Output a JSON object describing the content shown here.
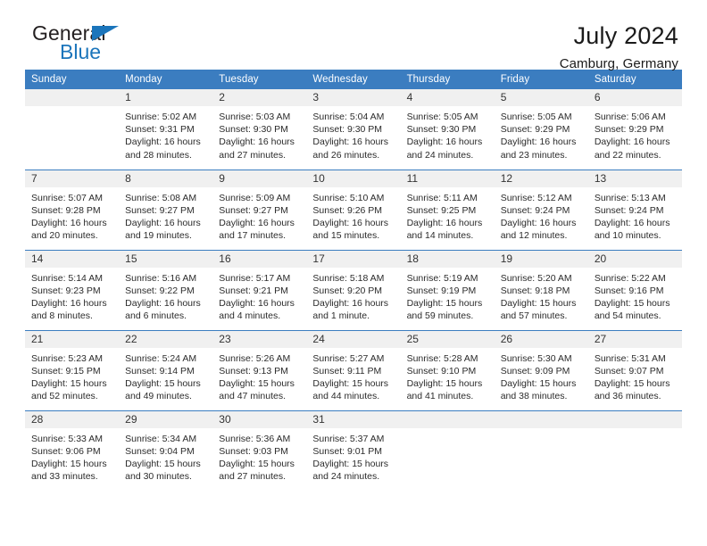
{
  "brand": {
    "name_top": "General",
    "name_bottom": "Blue",
    "accent_color": "#1b75bb"
  },
  "header": {
    "title": "July 2024",
    "subtitle": "Camburg, Germany"
  },
  "calendar": {
    "header_bg": "#3b7dc0",
    "weekdays": [
      "Sunday",
      "Monday",
      "Tuesday",
      "Wednesday",
      "Thursday",
      "Friday",
      "Saturday"
    ],
    "weeks": [
      [
        {
          "day": "",
          "blank": true,
          "sunrise": "",
          "sunset": "",
          "daylight1": "",
          "daylight2": ""
        },
        {
          "day": "1",
          "blank": false,
          "sunrise": "Sunrise: 5:02 AM",
          "sunset": "Sunset: 9:31 PM",
          "daylight1": "Daylight: 16 hours",
          "daylight2": "and 28 minutes."
        },
        {
          "day": "2",
          "blank": false,
          "sunrise": "Sunrise: 5:03 AM",
          "sunset": "Sunset: 9:30 PM",
          "daylight1": "Daylight: 16 hours",
          "daylight2": "and 27 minutes."
        },
        {
          "day": "3",
          "blank": false,
          "sunrise": "Sunrise: 5:04 AM",
          "sunset": "Sunset: 9:30 PM",
          "daylight1": "Daylight: 16 hours",
          "daylight2": "and 26 minutes."
        },
        {
          "day": "4",
          "blank": false,
          "sunrise": "Sunrise: 5:05 AM",
          "sunset": "Sunset: 9:30 PM",
          "daylight1": "Daylight: 16 hours",
          "daylight2": "and 24 minutes."
        },
        {
          "day": "5",
          "blank": false,
          "sunrise": "Sunrise: 5:05 AM",
          "sunset": "Sunset: 9:29 PM",
          "daylight1": "Daylight: 16 hours",
          "daylight2": "and 23 minutes."
        },
        {
          "day": "6",
          "blank": false,
          "sunrise": "Sunrise: 5:06 AM",
          "sunset": "Sunset: 9:29 PM",
          "daylight1": "Daylight: 16 hours",
          "daylight2": "and 22 minutes."
        }
      ],
      [
        {
          "day": "7",
          "blank": false,
          "sunrise": "Sunrise: 5:07 AM",
          "sunset": "Sunset: 9:28 PM",
          "daylight1": "Daylight: 16 hours",
          "daylight2": "and 20 minutes."
        },
        {
          "day": "8",
          "blank": false,
          "sunrise": "Sunrise: 5:08 AM",
          "sunset": "Sunset: 9:27 PM",
          "daylight1": "Daylight: 16 hours",
          "daylight2": "and 19 minutes."
        },
        {
          "day": "9",
          "blank": false,
          "sunrise": "Sunrise: 5:09 AM",
          "sunset": "Sunset: 9:27 PM",
          "daylight1": "Daylight: 16 hours",
          "daylight2": "and 17 minutes."
        },
        {
          "day": "10",
          "blank": false,
          "sunrise": "Sunrise: 5:10 AM",
          "sunset": "Sunset: 9:26 PM",
          "daylight1": "Daylight: 16 hours",
          "daylight2": "and 15 minutes."
        },
        {
          "day": "11",
          "blank": false,
          "sunrise": "Sunrise: 5:11 AM",
          "sunset": "Sunset: 9:25 PM",
          "daylight1": "Daylight: 16 hours",
          "daylight2": "and 14 minutes."
        },
        {
          "day": "12",
          "blank": false,
          "sunrise": "Sunrise: 5:12 AM",
          "sunset": "Sunset: 9:24 PM",
          "daylight1": "Daylight: 16 hours",
          "daylight2": "and 12 minutes."
        },
        {
          "day": "13",
          "blank": false,
          "sunrise": "Sunrise: 5:13 AM",
          "sunset": "Sunset: 9:24 PM",
          "daylight1": "Daylight: 16 hours",
          "daylight2": "and 10 minutes."
        }
      ],
      [
        {
          "day": "14",
          "blank": false,
          "sunrise": "Sunrise: 5:14 AM",
          "sunset": "Sunset: 9:23 PM",
          "daylight1": "Daylight: 16 hours",
          "daylight2": "and 8 minutes."
        },
        {
          "day": "15",
          "blank": false,
          "sunrise": "Sunrise: 5:16 AM",
          "sunset": "Sunset: 9:22 PM",
          "daylight1": "Daylight: 16 hours",
          "daylight2": "and 6 minutes."
        },
        {
          "day": "16",
          "blank": false,
          "sunrise": "Sunrise: 5:17 AM",
          "sunset": "Sunset: 9:21 PM",
          "daylight1": "Daylight: 16 hours",
          "daylight2": "and 4 minutes."
        },
        {
          "day": "17",
          "blank": false,
          "sunrise": "Sunrise: 5:18 AM",
          "sunset": "Sunset: 9:20 PM",
          "daylight1": "Daylight: 16 hours",
          "daylight2": "and 1 minute."
        },
        {
          "day": "18",
          "blank": false,
          "sunrise": "Sunrise: 5:19 AM",
          "sunset": "Sunset: 9:19 PM",
          "daylight1": "Daylight: 15 hours",
          "daylight2": "and 59 minutes."
        },
        {
          "day": "19",
          "blank": false,
          "sunrise": "Sunrise: 5:20 AM",
          "sunset": "Sunset: 9:18 PM",
          "daylight1": "Daylight: 15 hours",
          "daylight2": "and 57 minutes."
        },
        {
          "day": "20",
          "blank": false,
          "sunrise": "Sunrise: 5:22 AM",
          "sunset": "Sunset: 9:16 PM",
          "daylight1": "Daylight: 15 hours",
          "daylight2": "and 54 minutes."
        }
      ],
      [
        {
          "day": "21",
          "blank": false,
          "sunrise": "Sunrise: 5:23 AM",
          "sunset": "Sunset: 9:15 PM",
          "daylight1": "Daylight: 15 hours",
          "daylight2": "and 52 minutes."
        },
        {
          "day": "22",
          "blank": false,
          "sunrise": "Sunrise: 5:24 AM",
          "sunset": "Sunset: 9:14 PM",
          "daylight1": "Daylight: 15 hours",
          "daylight2": "and 49 minutes."
        },
        {
          "day": "23",
          "blank": false,
          "sunrise": "Sunrise: 5:26 AM",
          "sunset": "Sunset: 9:13 PM",
          "daylight1": "Daylight: 15 hours",
          "daylight2": "and 47 minutes."
        },
        {
          "day": "24",
          "blank": false,
          "sunrise": "Sunrise: 5:27 AM",
          "sunset": "Sunset: 9:11 PM",
          "daylight1": "Daylight: 15 hours",
          "daylight2": "and 44 minutes."
        },
        {
          "day": "25",
          "blank": false,
          "sunrise": "Sunrise: 5:28 AM",
          "sunset": "Sunset: 9:10 PM",
          "daylight1": "Daylight: 15 hours",
          "daylight2": "and 41 minutes."
        },
        {
          "day": "26",
          "blank": false,
          "sunrise": "Sunrise: 5:30 AM",
          "sunset": "Sunset: 9:09 PM",
          "daylight1": "Daylight: 15 hours",
          "daylight2": "and 38 minutes."
        },
        {
          "day": "27",
          "blank": false,
          "sunrise": "Sunrise: 5:31 AM",
          "sunset": "Sunset: 9:07 PM",
          "daylight1": "Daylight: 15 hours",
          "daylight2": "and 36 minutes."
        }
      ],
      [
        {
          "day": "28",
          "blank": false,
          "sunrise": "Sunrise: 5:33 AM",
          "sunset": "Sunset: 9:06 PM",
          "daylight1": "Daylight: 15 hours",
          "daylight2": "and 33 minutes."
        },
        {
          "day": "29",
          "blank": false,
          "sunrise": "Sunrise: 5:34 AM",
          "sunset": "Sunset: 9:04 PM",
          "daylight1": "Daylight: 15 hours",
          "daylight2": "and 30 minutes."
        },
        {
          "day": "30",
          "blank": false,
          "sunrise": "Sunrise: 5:36 AM",
          "sunset": "Sunset: 9:03 PM",
          "daylight1": "Daylight: 15 hours",
          "daylight2": "and 27 minutes."
        },
        {
          "day": "31",
          "blank": false,
          "sunrise": "Sunrise: 5:37 AM",
          "sunset": "Sunset: 9:01 PM",
          "daylight1": "Daylight: 15 hours",
          "daylight2": "and 24 minutes."
        },
        {
          "day": "",
          "blank": true,
          "sunrise": "",
          "sunset": "",
          "daylight1": "",
          "daylight2": ""
        },
        {
          "day": "",
          "blank": true,
          "sunrise": "",
          "sunset": "",
          "daylight1": "",
          "daylight2": ""
        },
        {
          "day": "",
          "blank": true,
          "sunrise": "",
          "sunset": "",
          "daylight1": "",
          "daylight2": ""
        }
      ]
    ]
  }
}
